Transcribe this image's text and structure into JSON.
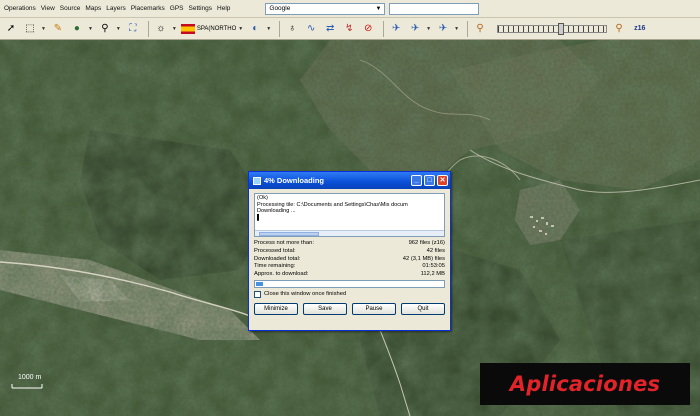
{
  "menu": {
    "items": [
      "Operations",
      "View",
      "Source",
      "Maps",
      "Layers",
      "Placemarks",
      "GPS",
      "Settings",
      "Help"
    ],
    "search_value": "Google"
  },
  "toolbar": {
    "layer_name": "SPA(NORTHO",
    "zoom_level": "z16",
    "layer_opacity_fraction": 0.6,
    "icons": [
      "pointer-icon",
      "select-area-icon",
      "ruler-icon",
      "globe-icon",
      "magnifier-icon",
      "fit-icon",
      "satellite-icon",
      "flag-icon",
      "earth-icon",
      "placemark-icon",
      "route-icon",
      "link-icon",
      "track-icon",
      "stop-icon",
      "gps-icon",
      "gps-track-icon",
      "gps-center-icon",
      "zoom-out-icon",
      "zoom-in-icon"
    ]
  },
  "map": {
    "scale_label": "1000 m"
  },
  "dialog": {
    "title": "4% Downloading",
    "log_lines": [
      "(Ok)",
      "Processing tile: C:\\Documents and Settings\\Chas\\Mis docum",
      "Downloading ..."
    ],
    "stats": [
      {
        "label": "Process not more than:",
        "value": "962 files (z16)"
      },
      {
        "label": "Processed total:",
        "value": "42 files"
      },
      {
        "label": "Downloaded total:",
        "value": "42 (3,1 MB) files"
      },
      {
        "label": "Time remaining:",
        "value": "01:53:05"
      },
      {
        "label": "Approx. to download:",
        "value": "112,2 MB"
      }
    ],
    "progress_fraction": 0.04,
    "close_checkbox_label": "Close this window once finished",
    "buttons": {
      "minimize": "Minimize",
      "save": "Save",
      "pause": "Pause",
      "quit": "Quit"
    }
  },
  "banner": {
    "text": "Aplicaciones",
    "color": "#e2232a"
  }
}
